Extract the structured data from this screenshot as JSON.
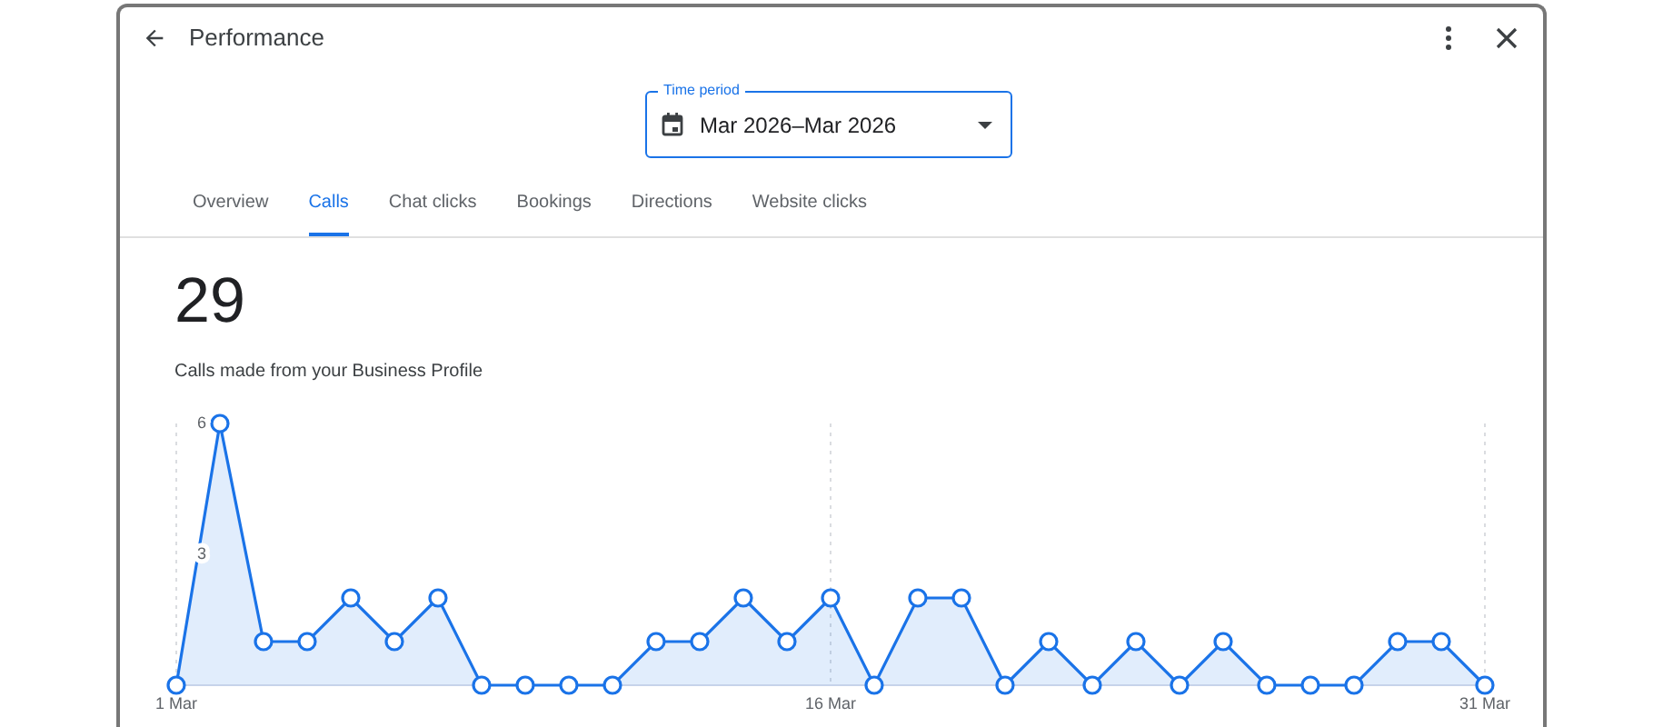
{
  "header": {
    "title": "Performance"
  },
  "time_period": {
    "label": "Time period",
    "value": "Mar 2026–Mar 2026"
  },
  "tabs": [
    {
      "label": "Overview",
      "selected": false
    },
    {
      "label": "Calls",
      "selected": true
    },
    {
      "label": "Chat clicks",
      "selected": false
    },
    {
      "label": "Bookings",
      "selected": false
    },
    {
      "label": "Directions",
      "selected": false
    },
    {
      "label": "Website clicks",
      "selected": false
    }
  ],
  "metric": {
    "value": "29",
    "caption": "Calls made from your Business Profile"
  },
  "chart_data": {
    "type": "area",
    "categories": [
      "1 Mar",
      null,
      null,
      null,
      null,
      null,
      null,
      null,
      null,
      null,
      null,
      null,
      null,
      null,
      null,
      "16 Mar",
      null,
      null,
      null,
      null,
      null,
      null,
      null,
      null,
      null,
      null,
      null,
      null,
      null,
      null,
      "31 Mar"
    ],
    "series": [
      {
        "color": "#1a73e8",
        "values": [
          0,
          6,
          1,
          1,
          2,
          1,
          2,
          0,
          0,
          0,
          0,
          1,
          1,
          2,
          1,
          2,
          0,
          2,
          2,
          0,
          1,
          0,
          1,
          0,
          1,
          0,
          0,
          0,
          1,
          1,
          0
        ]
      }
    ],
    "yticks": [
      3,
      6
    ],
    "ylim": [
      0,
      6
    ]
  }
}
